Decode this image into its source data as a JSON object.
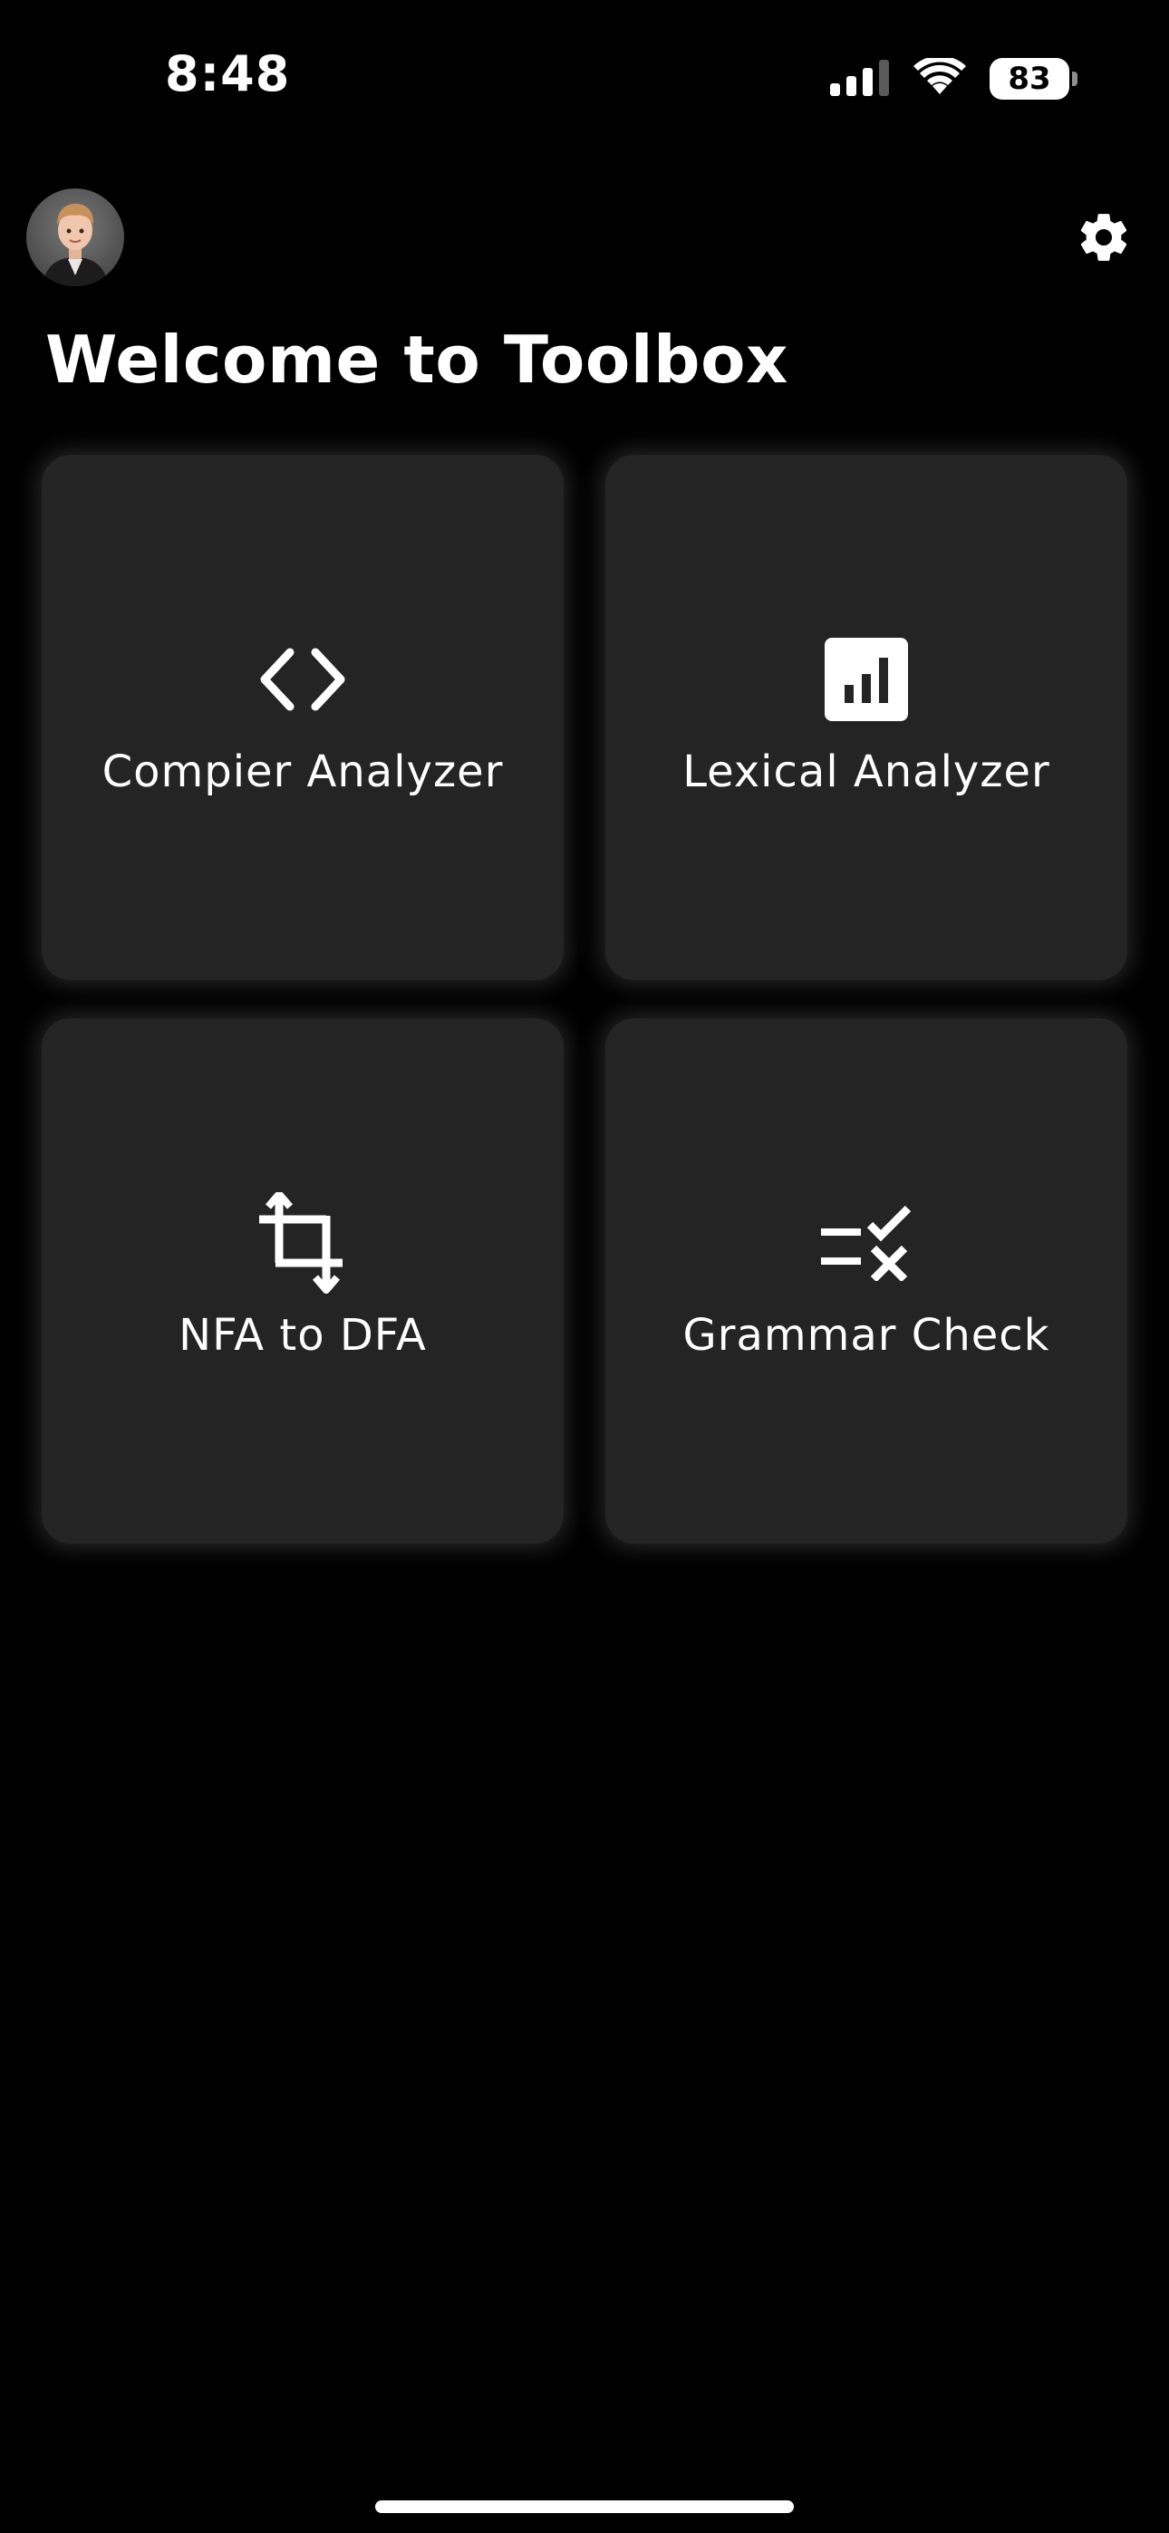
{
  "status_bar": {
    "time": "8:48",
    "battery_level": "83",
    "icons": [
      "cellular-signal-icon",
      "wifi-icon",
      "battery-icon"
    ]
  },
  "header": {
    "avatar": "memoji-avatar",
    "settings_icon": "gear-icon",
    "title": "Welcome to Toolbox"
  },
  "tools": [
    {
      "label": "Compier Analyzer",
      "icon": "code-brackets-icon"
    },
    {
      "label": "Lexical Analyzer",
      "icon": "bar-chart-icon"
    },
    {
      "label": "NFA to DFA",
      "icon": "crop-rotate-icon"
    },
    {
      "label": "Grammar Check",
      "icon": "rule-check-icon"
    }
  ],
  "colors": {
    "background": "#000000",
    "card": "#242424",
    "text": "#ffffff"
  }
}
